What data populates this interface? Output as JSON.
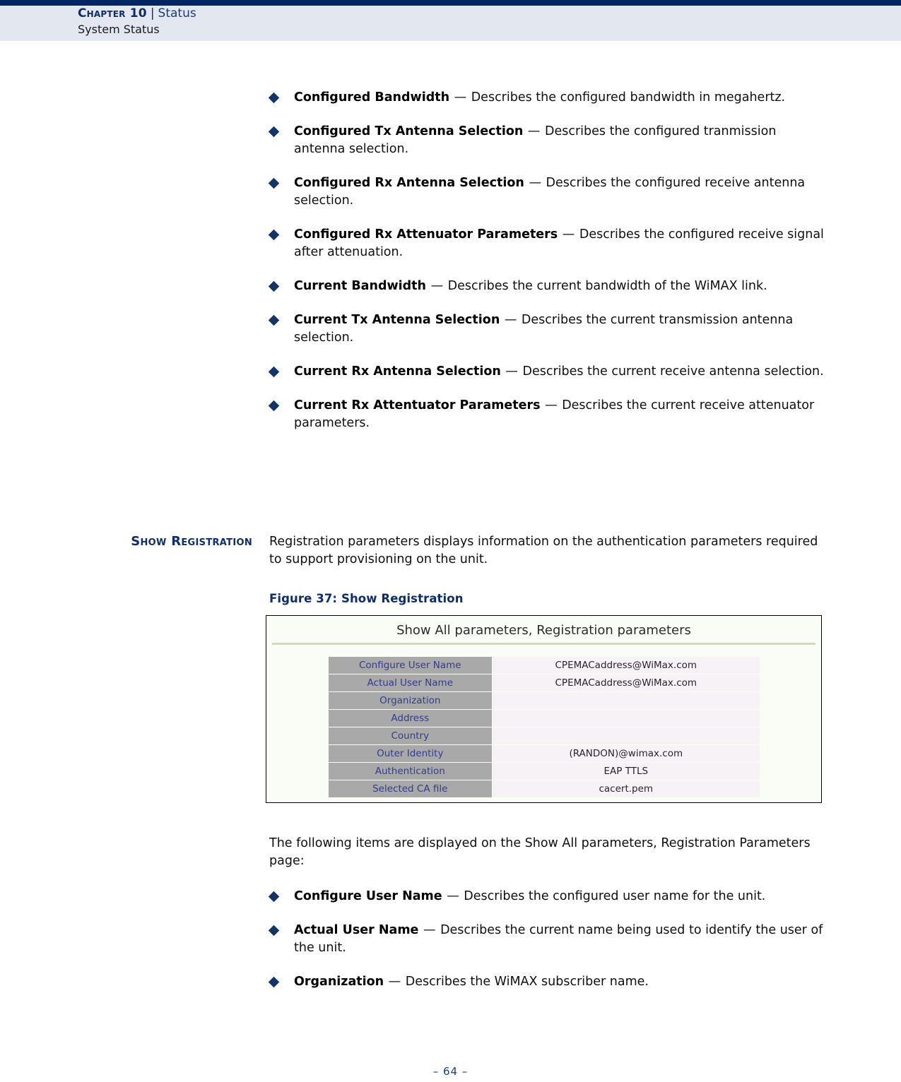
{
  "header": {
    "chapter_label": "Chapter 10",
    "separator": "|",
    "topic": "Status",
    "subtitle": "System Status"
  },
  "colors": {
    "navy_rule": "#002663",
    "header_band": "#e3e7f0",
    "heading_navy": "#0d2d6b",
    "bullet_diamond": "#123566",
    "table_label_bg": "#a9a9a9",
    "table_label_text": "#333b8f",
    "table_value_bg": "#f6f2f6",
    "figure_bg": "#fafcf6",
    "figure_divider": "#d6d4c2"
  },
  "top_bullets": [
    {
      "term": "Configured Bandwidth",
      "dash": "—",
      "description": "Describes the configured bandwidth in megahertz."
    },
    {
      "term": "Configured Tx Antenna Selection",
      "dash": "—",
      "description": "Describes the configured tranmission antenna selection."
    },
    {
      "term": "Configured Rx Antenna Selection",
      "dash": "—",
      "description": "Describes the configured receive antenna selection."
    },
    {
      "term": "Configured Rx Attenuator Parameters",
      "dash": "—",
      "description": "Describes the configured receive signal after attenuation."
    },
    {
      "term": "Current Bandwidth",
      "dash": "—",
      "description": "Describes the current bandwidth of the WiMAX link."
    },
    {
      "term": "Current Tx Antenna Selection",
      "dash": "—",
      "description": "Describes the current transmission antenna selection."
    },
    {
      "term": "Current Rx Antenna Selection",
      "dash": "—",
      "description": "Describes the current receive antenna selection."
    },
    {
      "term": "Current Rx Attentuator Parameters",
      "dash": "—",
      "description": "Describes the current receive attenuator parameters."
    }
  ],
  "section": {
    "side_heading": "Show Registration",
    "paragraph": "Registration parameters displays information on the authentication parameters required to support provisioning on the unit.",
    "figure_caption": "Figure 37:  Show Registration"
  },
  "figure": {
    "title": "Show All parameters, Registration parameters",
    "rows": [
      {
        "label": "Configure User Name",
        "value": "CPEMACaddress@WiMax.com"
      },
      {
        "label": "Actual User Name",
        "value": "CPEMACaddress@WiMax.com"
      },
      {
        "label": "Organization",
        "value": ""
      },
      {
        "label": "Address",
        "value": ""
      },
      {
        "label": "Country",
        "value": ""
      },
      {
        "label": "Outer Identity",
        "value": "(RANDON)@wimax.com"
      },
      {
        "label": "Authentication",
        "value": "EAP TTLS"
      },
      {
        "label": "Selected CA file",
        "value": "cacert.pem"
      }
    ]
  },
  "after_figure": {
    "paragraph": "The following items are displayed on the Show All parameters, Registration Parameters page:"
  },
  "bottom_bullets": [
    {
      "term": "Configure User Name",
      "dash": "—",
      "description": "Describes the configured user name for the unit."
    },
    {
      "term": "Actual User Name",
      "dash": "—",
      "description": "Describes the current name being used to identify the user of the unit."
    },
    {
      "term": "Organization",
      "dash": "—",
      "description": "Describes the WiMAX subscriber name."
    }
  ],
  "footer": {
    "page_number": "–  64  –"
  }
}
